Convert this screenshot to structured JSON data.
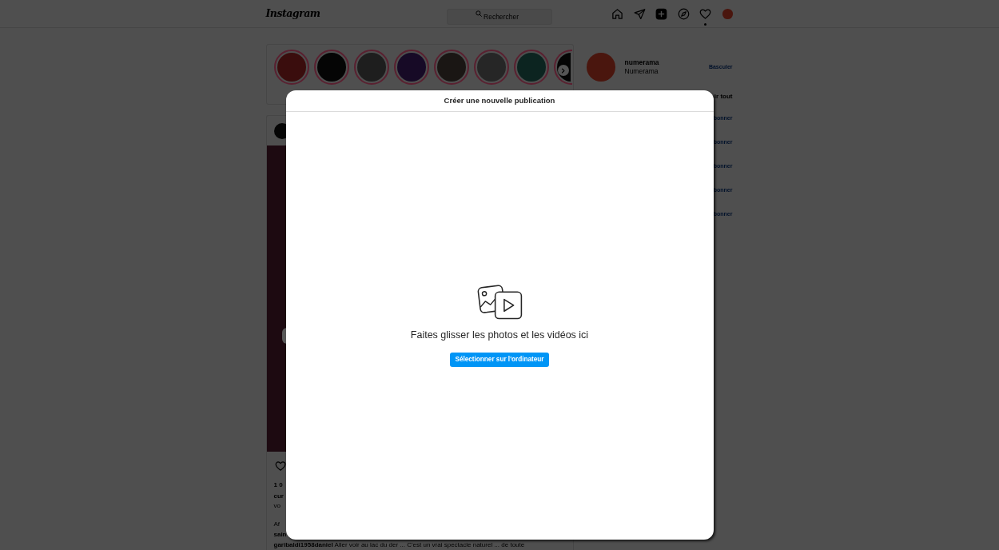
{
  "top_nav": {
    "logo": "Instagram",
    "search": {
      "placeholder": "Rechercher"
    },
    "items": [
      {
        "kind": "home",
        "selected": false,
        "dot": false
      },
      {
        "kind": "direct",
        "selected": false,
        "dot": false
      },
      {
        "kind": "new_post",
        "selected": true,
        "dot": false
      },
      {
        "kind": "explore",
        "selected": false,
        "dot": false
      },
      {
        "kind": "activity",
        "selected": false,
        "dot": true
      },
      {
        "kind": "profile",
        "selected": false,
        "dot": false
      }
    ]
  },
  "stories": {
    "items": [
      {
        "color": "#3a0d0d"
      },
      {
        "color": "#050505"
      },
      {
        "color": "#1e1e1e"
      },
      {
        "color": "#170a26"
      },
      {
        "color": "#1a1614"
      },
      {
        "color": "#262626"
      },
      {
        "color": "#0c2420"
      },
      {
        "color": "#050505"
      }
    ]
  },
  "post": {
    "likes": "1 0",
    "caption": {
      "user": "cur",
      "next_line": "vo"
    },
    "view_comments": "Af",
    "comments": [
      {
        "user": "sain"
      },
      {
        "user": "garibaldi1958daniel",
        "text": "Aller voir au lac du der ... C'est un vrai spectacle naturel ... de toute"
      }
    ]
  },
  "sidebar": {
    "profile": {
      "username": "numerama",
      "name": "Numerama",
      "switch": "Basculer"
    },
    "see_all": "ir tout",
    "suggestions": [
      {
        "follow": "bonner"
      },
      {
        "follow": "bonner"
      },
      {
        "follow": "bonner"
      },
      {
        "follow": "bonner"
      },
      {
        "follow": "bonner"
      }
    ]
  },
  "dialog": {
    "title": "Créer une nouvelle publication",
    "message": "Faites glisser les photos et les vidéos ici",
    "button": "Sélectionner sur l'ordinateur"
  }
}
